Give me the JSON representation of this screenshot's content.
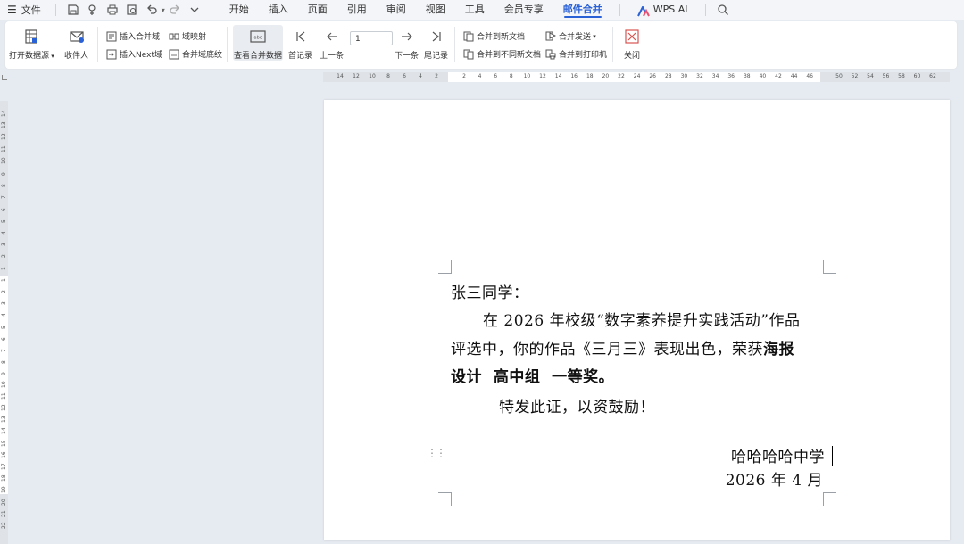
{
  "menubar": {
    "file_label": "文件",
    "tabs": [
      "开始",
      "插入",
      "页面",
      "引用",
      "审阅",
      "视图",
      "工具",
      "会员专享",
      "邮件合并",
      "WPS AI"
    ],
    "active_tab": "邮件合并",
    "accent_color": "#2a61d6"
  },
  "ribbon": {
    "open_datasource": "打开数据源",
    "recipients": "收件人",
    "insert_merge_field": "插入合并域",
    "insert_next_field": "插入Next域",
    "field_mapping": "域映射",
    "merge_field_shading": "合并域底纹",
    "view_merged_data": "查看合并数据",
    "first_record": "首记录",
    "prev_record": "上一条",
    "record_number": "1",
    "next_record": "下一条",
    "last_record": "尾记录",
    "merge_to_new_doc": "合并到新文档",
    "merge_to_different_docs": "合并到不同新文档",
    "merge_send": "合并发送",
    "merge_to_printer": "合并到打印机",
    "close": "关闭"
  },
  "ruler": {
    "h_ticks": [
      "14",
      "12",
      "10",
      "8",
      "6",
      "4",
      "2",
      "2",
      "4",
      "6",
      "8",
      "10",
      "12",
      "14",
      "16",
      "18",
      "20",
      "22",
      "24",
      "26",
      "28",
      "30",
      "32",
      "34",
      "36",
      "38",
      "40",
      "42",
      "44",
      "46",
      "50",
      "52",
      "54",
      "56",
      "58",
      "60",
      "62"
    ],
    "v_ticks": [
      "14",
      "13",
      "12",
      "11",
      "10",
      "9",
      "8",
      "7",
      "6",
      "5",
      "4",
      "3",
      "2",
      "1",
      "1",
      "2",
      "3",
      "4",
      "5",
      "6",
      "7",
      "8",
      "9",
      "10",
      "11",
      "12",
      "13",
      "14",
      "15",
      "16",
      "17",
      "18",
      "19",
      "20",
      "21",
      "22"
    ]
  },
  "document": {
    "salutation": "张三同学：",
    "body_line1": "在 2026 年校级“数字素养提升实践活动”作品",
    "body_line2_plain": "评选中，你的作品《三月三》表现出色，荣获",
    "body_line2_bold": "海报",
    "body_line3_bold": "设计  高中组  一等奖。",
    "body_line4": "特发此证，以资鼓励！",
    "signature": "哈哈哈哈中学",
    "date": "2026 年 4 月"
  }
}
